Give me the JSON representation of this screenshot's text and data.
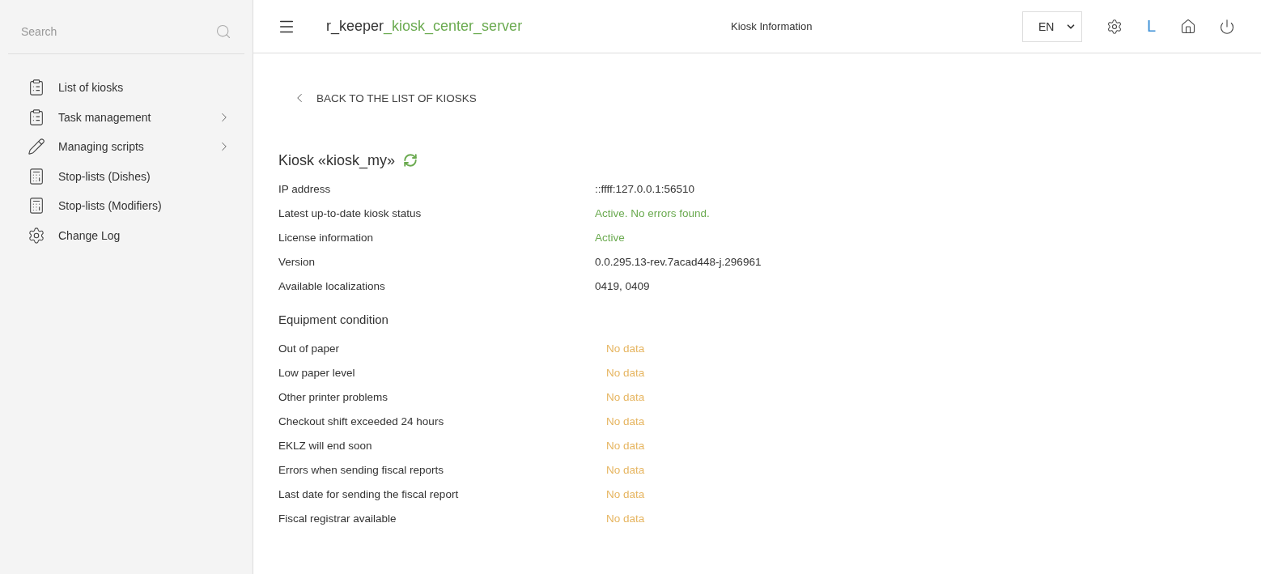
{
  "sidebar": {
    "search": {
      "placeholder": "Search"
    },
    "items": [
      {
        "label": "List of kiosks",
        "kind": "clipboard",
        "expandable": false
      },
      {
        "label": "Task management",
        "kind": "clipboard",
        "expandable": true
      },
      {
        "label": "Managing scripts",
        "kind": "pencil",
        "expandable": true
      },
      {
        "label": "Stop-lists (Dishes)",
        "kind": "register",
        "expandable": false
      },
      {
        "label": "Stop-lists (Modifiers)",
        "kind": "register",
        "expandable": false
      },
      {
        "label": "Change Log",
        "kind": "gear",
        "expandable": false
      }
    ]
  },
  "header": {
    "logo": {
      "prefix": "r_keeper",
      "suffix": "_kiosk_center_server"
    },
    "title": "Kiosk Information",
    "language": "EN",
    "user_initial": "L"
  },
  "back_link": "BACK TO THE LIST OF KIOSKS",
  "kiosk_title": "Kiosk «kiosk_my»",
  "info": [
    {
      "label": "IP address",
      "value": "::ffff:127.0.0.1:56510",
      "kind": "plain"
    },
    {
      "label": "Latest up-to-date kiosk status",
      "value": "Active. No errors found.",
      "kind": "ok"
    },
    {
      "label": "License information",
      "value": "Active",
      "kind": "ok"
    },
    {
      "label": "Version",
      "value": "0.0.295.13-rev.7acad448-j.296961",
      "kind": "plain"
    },
    {
      "label": "Available localizations",
      "value": "0419, 0409",
      "kind": "plain"
    }
  ],
  "equipment": {
    "title": "Equipment condition",
    "rows": [
      {
        "label": "Out of paper",
        "value": "No data",
        "kind": "nodata"
      },
      {
        "label": "Low paper level",
        "value": "No data",
        "kind": "nodata"
      },
      {
        "label": "Other printer problems",
        "value": "No data",
        "kind": "nodata"
      },
      {
        "label": "Checkout shift exceeded 24 hours",
        "value": "No data",
        "kind": "nodata"
      },
      {
        "label": "EKLZ will end soon",
        "value": "No data",
        "kind": "nodata"
      },
      {
        "label": "Errors when sending fiscal reports",
        "value": "No data",
        "kind": "nodata"
      },
      {
        "label": "Last date for sending the fiscal report",
        "value": "No data",
        "kind": "nodata"
      },
      {
        "label": "Fiscal registrar available",
        "value": "No data",
        "kind": "nodata"
      }
    ]
  }
}
